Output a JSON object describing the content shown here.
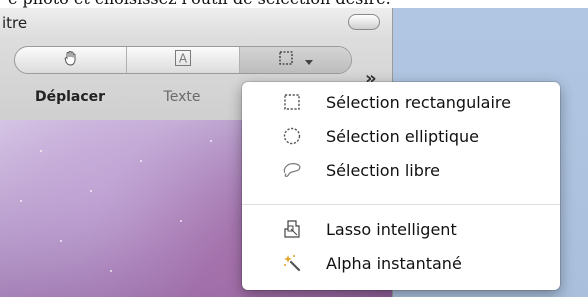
{
  "caption": {
    "text": "e photo et choisissez l'outil de sélection désiré."
  },
  "window": {
    "title": "itre",
    "toolbar": {
      "buttons": [
        {
          "label": "Déplacer",
          "icon": "hand-icon"
        },
        {
          "label": "Texte",
          "icon": "text-tool-icon"
        },
        {
          "label": "",
          "icon": "rect-selection-icon"
        }
      ],
      "overflow": "»"
    }
  },
  "selection_menu": {
    "items": [
      {
        "label": "Sélection rectangulaire",
        "icon": "rect-selection-icon"
      },
      {
        "label": "Sélection elliptique",
        "icon": "ellipse-selection-icon"
      },
      {
        "label": "Sélection libre",
        "icon": "lasso-free-icon"
      },
      {
        "label": "Lasso intelligent",
        "icon": "smart-lasso-icon"
      },
      {
        "label": "Alpha instantané",
        "icon": "magic-wand-icon"
      }
    ]
  }
}
